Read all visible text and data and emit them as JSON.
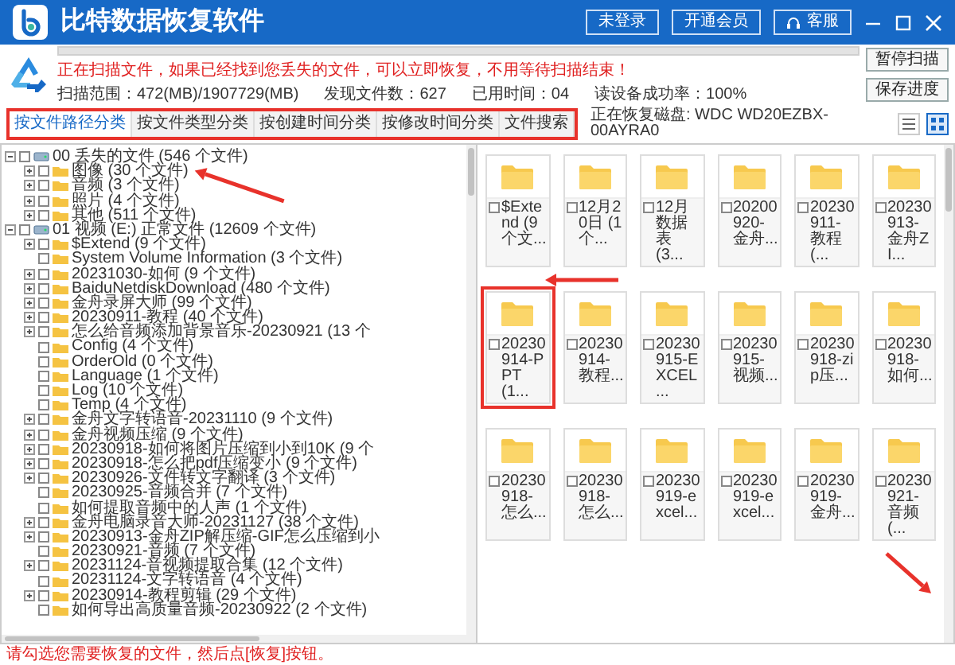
{
  "window": {
    "title": "比特数据恢复软件",
    "header_buttons": [
      {
        "label": "未登录",
        "kind": "plain"
      },
      {
        "label": "开通会员",
        "kind": "plain"
      },
      {
        "label": "客服",
        "kind": "support"
      }
    ]
  },
  "scan": {
    "progress": {
      "level": 0
    },
    "message": "正在扫描文件，如果已经找到您丢失的文件，可以立即恢复，不用等待扫描结束！",
    "stats": [
      "扫描范围：472(MB)/1907729(MB)",
      "发现文件数：627",
      "已用时间：04",
      "读设备成功率：100%"
    ],
    "buttons": [
      "暂停扫描",
      "保存进度"
    ]
  },
  "tabs": [
    {
      "label": "按文件路径分类",
      "selected": true
    },
    {
      "label": "按文件类型分类",
      "selected": false
    },
    {
      "label": "按创建时间分类",
      "selected": false
    },
    {
      "label": "按修改时间分类",
      "selected": false
    },
    {
      "label": "文件搜索",
      "selected": false
    }
  ],
  "disk_label": "正在恢复磁盘: WDC WD20EZBX-00AYRA0",
  "view_modes": [
    {
      "kind": "list",
      "selected": false
    },
    {
      "kind": "grid",
      "selected": true
    }
  ],
  "tree": [
    {
      "label": "00 丢失的文件 (546 个文件)",
      "kind": "drive",
      "expanded": true,
      "checked": false,
      "children": [
        {
          "label": "图像 (30 个文件)",
          "kind": "folder",
          "expanded": false,
          "checked": false
        },
        {
          "label": "音频 (3 个文件)",
          "kind": "folder",
          "expanded": false,
          "checked": false
        },
        {
          "label": "照片 (4 个文件)",
          "kind": "folder",
          "expanded": false,
          "checked": false
        },
        {
          "label": "其他 (511 个文件)",
          "kind": "folder",
          "expanded": false,
          "checked": false
        }
      ]
    },
    {
      "label": "01 视频 (E:) 正常文件 (12609 个文件)",
      "kind": "drive",
      "expanded": true,
      "checked": false,
      "children": [
        {
          "label": "$Extend (9 个文件)",
          "kind": "folder",
          "expanded": false,
          "checked": false
        },
        {
          "label": "System Volume Information (3 个文件)",
          "kind": "folder",
          "checked": false
        },
        {
          "label": "20231030-如何 (9 个文件)",
          "kind": "folder",
          "expanded": false,
          "checked": false
        },
        {
          "label": "BaiduNetdiskDownload (480 个文件)",
          "kind": "folder",
          "expanded": false,
          "checked": false
        },
        {
          "label": "金舟录屏大师 (99 个文件)",
          "kind": "folder",
          "expanded": false,
          "checked": false
        },
        {
          "label": "20230911-教程 (40 个文件)",
          "kind": "folder",
          "expanded": false,
          "checked": false
        },
        {
          "label": "怎么给音频添加背景音乐-20230921 (13 个",
          "kind": "folder",
          "expanded": false,
          "checked": false
        },
        {
          "label": "Config (4 个文件)",
          "kind": "folder",
          "checked": false
        },
        {
          "label": "OrderOld (0 个文件)",
          "kind": "folder",
          "checked": false
        },
        {
          "label": "Language (1 个文件)",
          "kind": "folder",
          "checked": false
        },
        {
          "label": "Log (10 个文件)",
          "kind": "folder",
          "checked": false
        },
        {
          "label": "Temp (4 个文件)",
          "kind": "folder",
          "checked": false
        },
        {
          "label": "金舟文字转语音-20231110 (9 个文件)",
          "kind": "folder",
          "expanded": false,
          "checked": false
        },
        {
          "label": "金舟视频压缩 (9 个文件)",
          "kind": "folder",
          "expanded": false,
          "checked": false
        },
        {
          "label": "20230918-如何将图片压缩到小到10K (9 个",
          "kind": "folder",
          "expanded": false,
          "checked": false
        },
        {
          "label": "20230918-怎么把pdf压缩变小 (9 个文件)",
          "kind": "folder",
          "expanded": false,
          "checked": false
        },
        {
          "label": "20230926-文件转文字翻译 (3 个文件)",
          "kind": "folder",
          "expanded": false,
          "checked": false
        },
        {
          "label": "20230925-音频合并 (7 个文件)",
          "kind": "folder",
          "checked": false
        },
        {
          "label": "如何提取音频中的人声 (1 个文件)",
          "kind": "folder",
          "checked": false
        },
        {
          "label": "金舟电脑录音大师-20231127 (38 个文件)",
          "kind": "folder",
          "expanded": false,
          "checked": false
        },
        {
          "label": "20230913-金舟ZIP解压缩-GIF怎么压缩到小",
          "kind": "folder",
          "expanded": false,
          "checked": false
        },
        {
          "label": "20230921-音频 (7 个文件)",
          "kind": "folder",
          "checked": false
        },
        {
          "label": "20231124-音视频提取合集 (12 个文件)",
          "kind": "folder",
          "expanded": false,
          "checked": false
        },
        {
          "label": "20231124-文字转语音 (4 个文件)",
          "kind": "folder",
          "checked": false
        },
        {
          "label": "20230914-教程剪辑 (29 个文件)",
          "kind": "folder",
          "expanded": false,
          "checked": false
        },
        {
          "label": "如何导出高质量音频-20230922 (2 个文件)",
          "kind": "folder",
          "checked": false
        }
      ]
    }
  ],
  "tiles": [
    {
      "label": "$Extend (9 个文...",
      "checked": false,
      "highlighted": false
    },
    {
      "label": "12月20日 (1 个...",
      "checked": false,
      "highlighted": false
    },
    {
      "label": "12月数据表 (3...",
      "checked": false,
      "highlighted": false
    },
    {
      "label": "20200920-金舟...",
      "checked": false,
      "highlighted": false
    },
    {
      "label": "20230911-教程 (...",
      "checked": false,
      "highlighted": false
    },
    {
      "label": "20230913-金舟ZI...",
      "checked": false,
      "highlighted": false
    },
    {
      "label": "20230914-PPT (1...",
      "checked": false,
      "highlighted": true
    },
    {
      "label": "20230914-教程...",
      "checked": false,
      "highlighted": false
    },
    {
      "label": "20230915-EXCEL ...",
      "checked": false,
      "highlighted": false
    },
    {
      "label": "20230915-视频...",
      "checked": false,
      "highlighted": false
    },
    {
      "label": "20230918-zip压...",
      "checked": false,
      "highlighted": false
    },
    {
      "label": "20230918-如何...",
      "checked": false,
      "highlighted": false
    },
    {
      "label": "20230918-怎么...",
      "checked": false,
      "highlighted": false
    },
    {
      "label": "20230918-怎么...",
      "checked": false,
      "highlighted": false
    },
    {
      "label": "20230919-excel...",
      "checked": false,
      "highlighted": false
    },
    {
      "label": "20230919-excel...",
      "checked": false,
      "highlighted": false
    },
    {
      "label": "20230919-金舟...",
      "checked": false,
      "highlighted": false
    },
    {
      "label": "20230921-音频 (...",
      "checked": false,
      "highlighted": false
    }
  ],
  "footer_hint": "请勾选您需要恢复的文件，然后点[恢复]按钮。"
}
